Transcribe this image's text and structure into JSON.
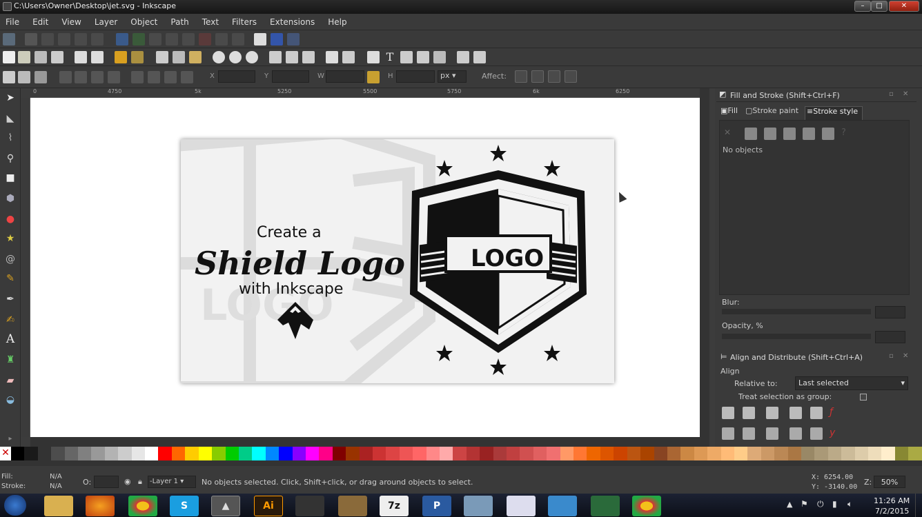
{
  "window": {
    "title": "C:\\Users\\Owner\\Desktop\\jet.svg - Inkscape"
  },
  "menu": [
    "File",
    "Edit",
    "View",
    "Layer",
    "Object",
    "Path",
    "Text",
    "Filters",
    "Extensions",
    "Help"
  ],
  "controls": {
    "x_label": "X",
    "y_label": "Y",
    "w_label": "W",
    "h_label": "H",
    "unit": "px",
    "affect_label": "Affect:"
  },
  "ruler_ticks": [
    "0",
    "4750",
    "5k",
    "5250",
    "5500",
    "5750",
    "6k",
    "6250"
  ],
  "artwork": {
    "create_a": "Create a",
    "shield_logo": "Shield Logo",
    "with_inkscape": "with Inkscape",
    "logo": "LOGO",
    "bg_logo": "LOGO"
  },
  "fill_stroke": {
    "title": "Fill and Stroke (Shift+Ctrl+F)",
    "tabs": [
      "Fill",
      "Stroke paint",
      "Stroke style"
    ],
    "no_objects": "No objects",
    "blur_label": "Blur:",
    "opacity_label": "Opacity, %"
  },
  "align": {
    "title": "Align and Distribute (Shift+Ctrl+A)",
    "section": "Align",
    "relative_to_label": "Relative to:",
    "relative_to_value": "Last selected",
    "treat_group_label": "Treat selection as group:"
  },
  "status": {
    "fill_label": "Fill:",
    "fill_value": "N/A",
    "stroke_label": "Stroke:",
    "stroke_value": "N/A",
    "o_label": "O:",
    "layer": "-Layer 1",
    "message": "No objects selected. Click, Shift+click, or drag around objects to select.",
    "x_coord": "X:   6254.00",
    "y_coord": "Y:  -3140.00",
    "zoom_label": "Z:",
    "zoom": "50%"
  },
  "taskbar": {
    "time": "11:26 AM",
    "date": "7/2/2015",
    "apps": [
      "explorer",
      "firefox",
      "chrome",
      "skype",
      "inkscape",
      "illustrator",
      "app7",
      "paint",
      "7zip",
      "publisher",
      "app11",
      "app12",
      "app13",
      "app14",
      "app15",
      "chrome2"
    ],
    "labels": {
      "illustrator": "Ai",
      "7zip": "7z",
      "publisher": "P"
    }
  },
  "colors": {
    "panel_bg": "#3a3a3a",
    "canvas_bg": "#ffffff",
    "palette": [
      "#000000",
      "#1a1a1a",
      "#333333",
      "#4d4d4d",
      "#666666",
      "#808080",
      "#999999",
      "#b3b3b3",
      "#cccccc",
      "#e6e6e6",
      "#ffffff",
      "#ff0000",
      "#ff6600",
      "#ffcc00",
      "#ffff00",
      "#88cc00",
      "#00cc00",
      "#00cc88",
      "#00ffff",
      "#0088ff",
      "#0000ff",
      "#8800ff",
      "#ff00ff",
      "#ff0088",
      "#800000",
      "#993300",
      "#aa2222",
      "#cc3333",
      "#dd4444",
      "#ee5555",
      "#ff6666",
      "#ff8888",
      "#ffaaaa",
      "#cc4444",
      "#b33333",
      "#992222",
      "#aa3a3a",
      "#c04040",
      "#d05050",
      "#e06060",
      "#f07070",
      "#ff9966",
      "#ff7733",
      "#ee6600",
      "#dd5500",
      "#cc4400",
      "#bb5511",
      "#aa4400",
      "#884422",
      "#aa6633",
      "#cc8844",
      "#dd9955",
      "#eeaa66",
      "#ffbb77",
      "#ffcc88",
      "#ddaa77",
      "#cc9966",
      "#bb8855",
      "#aa7744",
      "#998866",
      "#aa9977",
      "#bbaa88",
      "#ccbb99",
      "#ddccaa",
      "#eeddbb",
      "#ffeecc",
      "#888833",
      "#aaaa44"
    ]
  }
}
